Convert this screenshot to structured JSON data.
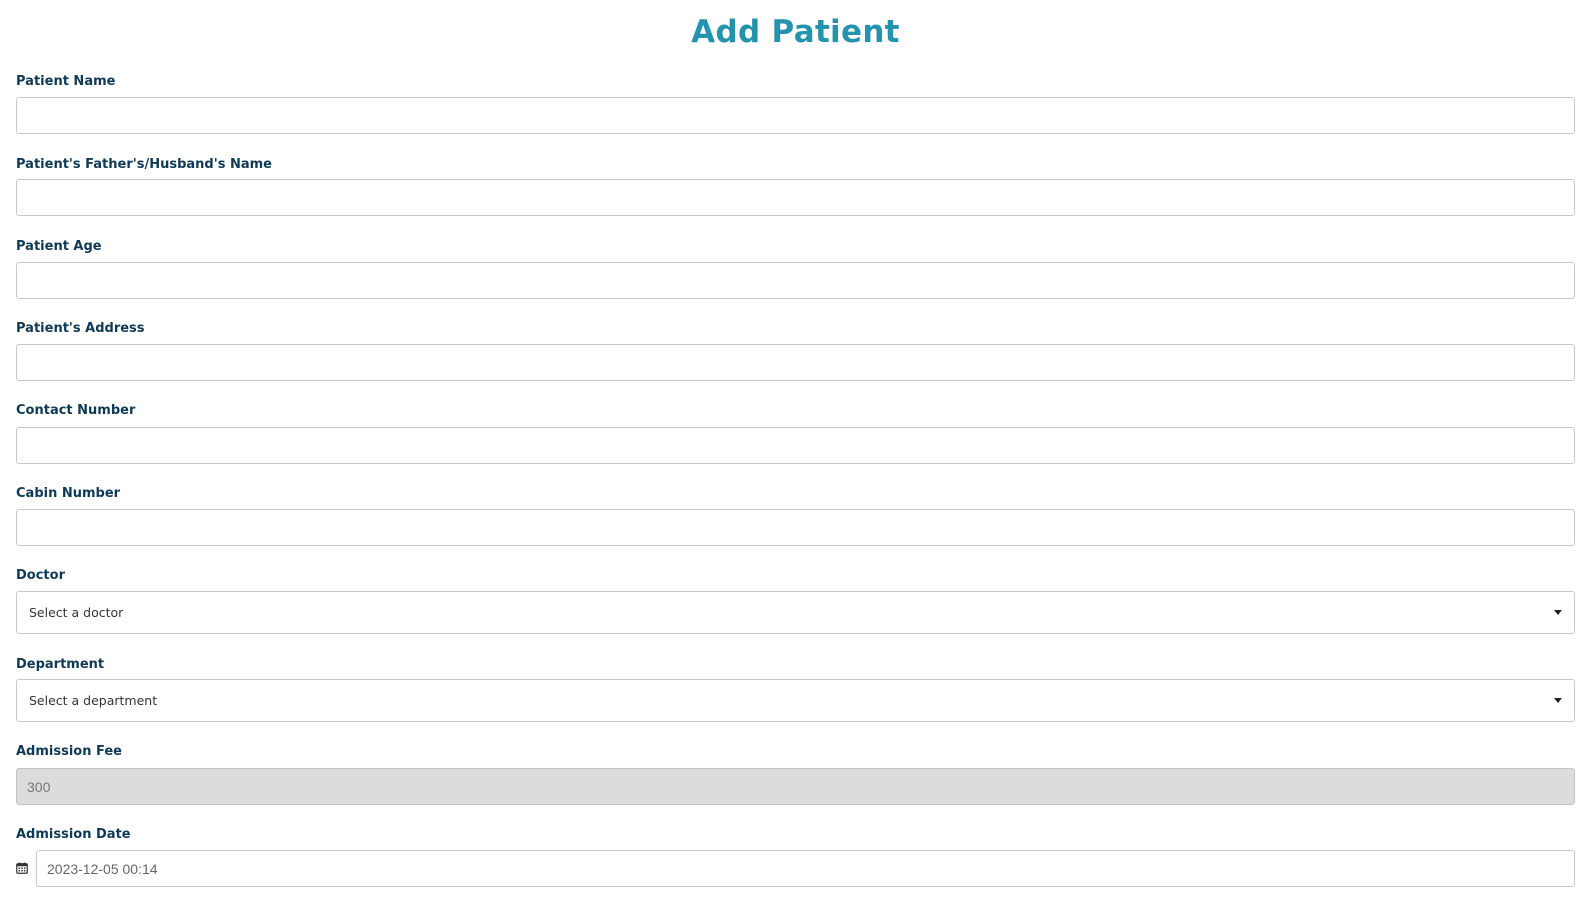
{
  "page": {
    "title": "Add Patient"
  },
  "fields": {
    "patient_name": {
      "label": "Patient Name",
      "value": ""
    },
    "guardian_name": {
      "label": "Patient's Father's/Husband's Name",
      "value": ""
    },
    "patient_age": {
      "label": "Patient Age",
      "value": ""
    },
    "patient_address": {
      "label": "Patient's Address",
      "value": ""
    },
    "contact_number": {
      "label": "Contact Number",
      "value": ""
    },
    "cabin_number": {
      "label": "Cabin Number",
      "value": ""
    },
    "doctor": {
      "label": "Doctor",
      "selected": "Select a doctor"
    },
    "department": {
      "label": "Department",
      "selected": "Select a department"
    },
    "admission_fee": {
      "label": "Admission Fee",
      "value": "300"
    },
    "admission_date": {
      "label": "Admission Date",
      "value": "2023-12-05 00:14"
    }
  },
  "icons": {
    "calendar": "calendar-icon",
    "dropdown": "chevron-down-icon"
  },
  "colors": {
    "title": "#2493ad",
    "label": "#0f3a55",
    "border": "#c9c9c9",
    "readonly_bg": "#dcdcdc"
  }
}
